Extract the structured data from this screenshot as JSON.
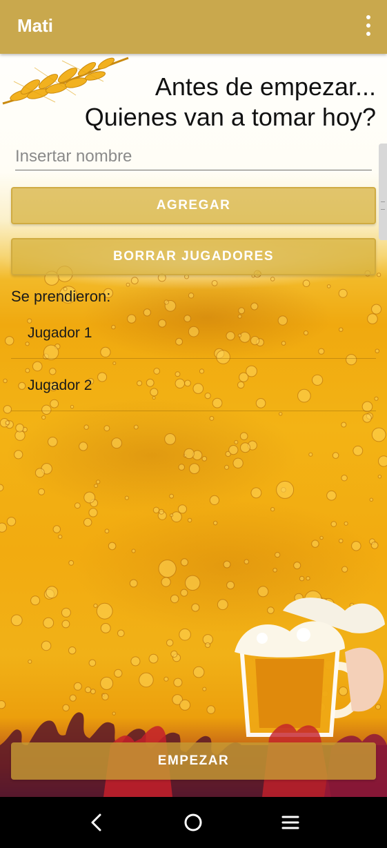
{
  "app_bar": {
    "title": "Mati",
    "menu_icon": "more-vert-icon"
  },
  "heading": {
    "line1": "Antes de empezar...",
    "line2": "Quienes van a tomar hoy?"
  },
  "name_input": {
    "placeholder": "Insertar nombre",
    "value": ""
  },
  "buttons": {
    "add": "AGREGAR",
    "clear": "BORRAR JUGADORES",
    "start": "EMPEZAR"
  },
  "players": {
    "label": "Se prendieron:",
    "items": [
      "Jugador 1",
      "Jugador 2"
    ]
  },
  "nav": {
    "back_icon": "back-icon",
    "home_icon": "home-icon",
    "recents_icon": "recents-icon"
  },
  "colors": {
    "app_bar": "#c9a84d",
    "button": "#d6b03c",
    "beer": "#f2ab10"
  }
}
